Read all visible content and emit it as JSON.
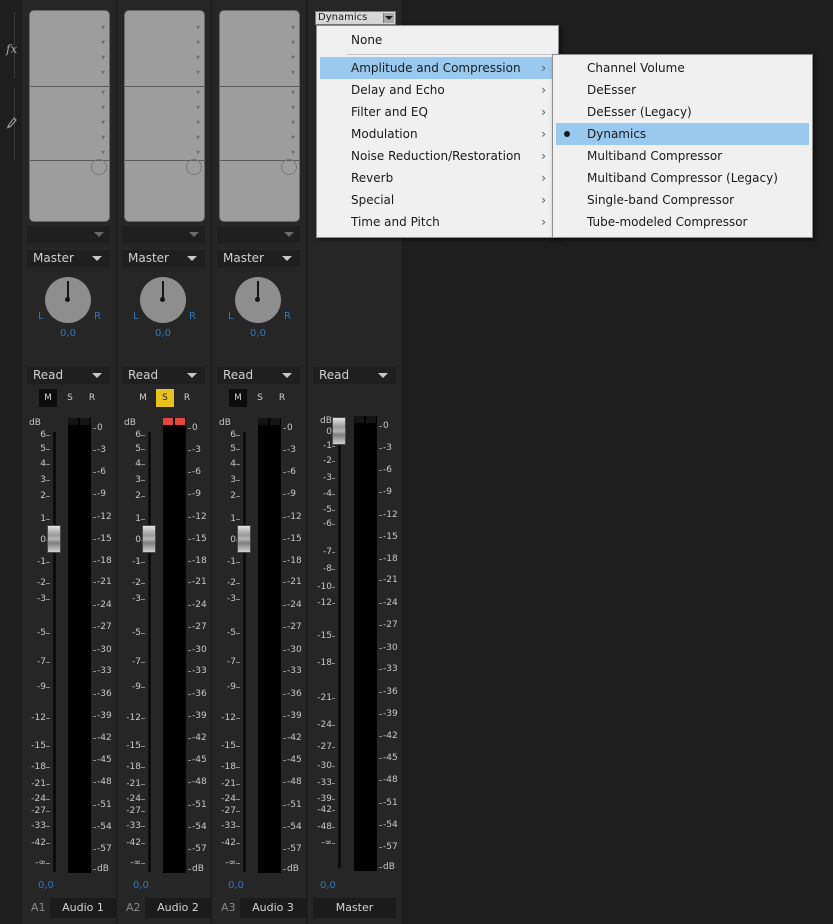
{
  "sidebar": {
    "icons": [
      "fx-icon",
      "pen-icon"
    ],
    "fx_text": "fx"
  },
  "strips": [
    {
      "id": "a1",
      "pan_value": "0,0",
      "pan_left": "L",
      "pan_right": "R",
      "output": "Master",
      "automation": "Read",
      "mute": "M",
      "solo": "S",
      "record": "R",
      "mute_on": true,
      "solo_on": false,
      "clip": false,
      "volume": "0,0",
      "track_label": "A1",
      "name": "Audio 1"
    },
    {
      "id": "a2",
      "pan_value": "0,0",
      "pan_left": "L",
      "pan_right": "R",
      "output": "Master",
      "automation": "Read",
      "mute": "M",
      "solo": "S",
      "record": "R",
      "mute_on": false,
      "solo_on": true,
      "clip": true,
      "volume": "0,0",
      "track_label": "A2",
      "name": "Audio 2"
    },
    {
      "id": "a3",
      "pan_value": "0,0",
      "pan_left": "L",
      "pan_right": "R",
      "output": "Master",
      "automation": "Read",
      "mute": "M",
      "solo": "S",
      "record": "R",
      "mute_on": true,
      "solo_on": false,
      "clip": false,
      "volume": "0,0",
      "track_label": "A3",
      "name": "Audio 3"
    }
  ],
  "master": {
    "automation": "Read",
    "volume": "0,0",
    "name": "Master",
    "fx_value": "Dynamics"
  },
  "fader_scale": [
    "dB",
    "6",
    "5",
    "4",
    "3",
    "2",
    "1",
    "0",
    "-1",
    "-2",
    "-3",
    "-5",
    "-7",
    "-9",
    "-12",
    "-15",
    "-18",
    "-21",
    "-24",
    "-27",
    "-33",
    "-42",
    "-∞"
  ],
  "master_fader_scale": [
    "dB",
    "0",
    "-1",
    "-2",
    "-3",
    "-4",
    "-5",
    "-6",
    "-7",
    "-8",
    "-10",
    "-12",
    "-15",
    "-18",
    "-21",
    "-24",
    "-27",
    "-30",
    "-33",
    "-39",
    "-42",
    "-48",
    "-∞"
  ],
  "meter_scale": [
    "0",
    "-3",
    "-6",
    "-9",
    "-12",
    "-15",
    "-18",
    "-21",
    "-24",
    "-27",
    "-30",
    "-33",
    "-36",
    "-39",
    "-42",
    "-45",
    "-48",
    "-51",
    "-54",
    "-57",
    "dB"
  ],
  "menu": {
    "none": "None",
    "categories": [
      "Amplitude and Compression",
      "Delay and Echo",
      "Filter and EQ",
      "Modulation",
      "Noise Reduction/Restoration",
      "Reverb",
      "Special",
      "Time and Pitch"
    ],
    "highlighted_category": "Amplitude and Compression",
    "submenu": [
      "Channel Volume",
      "DeEsser",
      "DeEsser (Legacy)",
      "Dynamics",
      "Multiband Compressor",
      "Multiband Compressor (Legacy)",
      "Single-band Compressor",
      "Tube-modeled Compressor"
    ],
    "selected_item": "Dynamics"
  },
  "colors": {
    "accent_blue": "#2f78bf",
    "solo_yellow": "#e8c21e",
    "clip_red": "#e64343",
    "menu_highlight": "#99c9ef"
  }
}
